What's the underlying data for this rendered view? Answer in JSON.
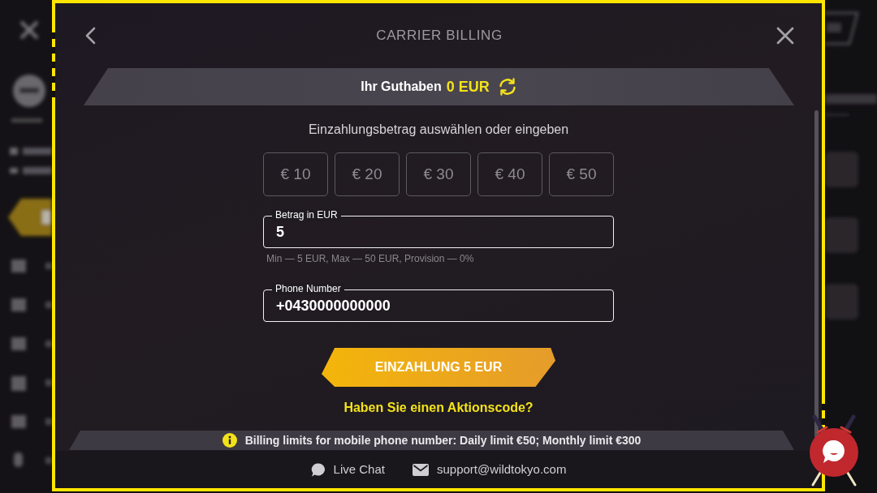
{
  "modal": {
    "title": "CARRIER BILLING"
  },
  "balance": {
    "label": "Ihr Guthaben",
    "amount": "0 EUR"
  },
  "amount_section": {
    "heading": "Einzahlungsbetrag auswählen oder eingeben",
    "presets": [
      {
        "label": "€ 10",
        "selected": false
      },
      {
        "label": "€ 20",
        "selected": false
      },
      {
        "label": "€ 30",
        "selected": false
      },
      {
        "label": "€ 40",
        "selected": false
      },
      {
        "label": "€ 50",
        "selected": false
      }
    ]
  },
  "fields": [
    {
      "label": "Betrag in EUR",
      "value": "5",
      "hint": "Min — 5 EUR, Max — 50 EUR, Provision — 0%"
    },
    {
      "label": "Phone Number",
      "value": "+0430000000000"
    }
  ],
  "submit_button": {
    "label": "EINZAHLUNG 5 EUR"
  },
  "promo_link": {
    "label": "Haben Sie einen Aktionscode?"
  },
  "notice": {
    "text": "Billing limits for mobile phone number: Daily limit €50; Monthly limit €300"
  },
  "footer": {
    "links": [
      {
        "kind": "chat",
        "label": "Live Chat"
      },
      {
        "kind": "email",
        "label": "support@wildtokyo.com"
      }
    ]
  }
}
